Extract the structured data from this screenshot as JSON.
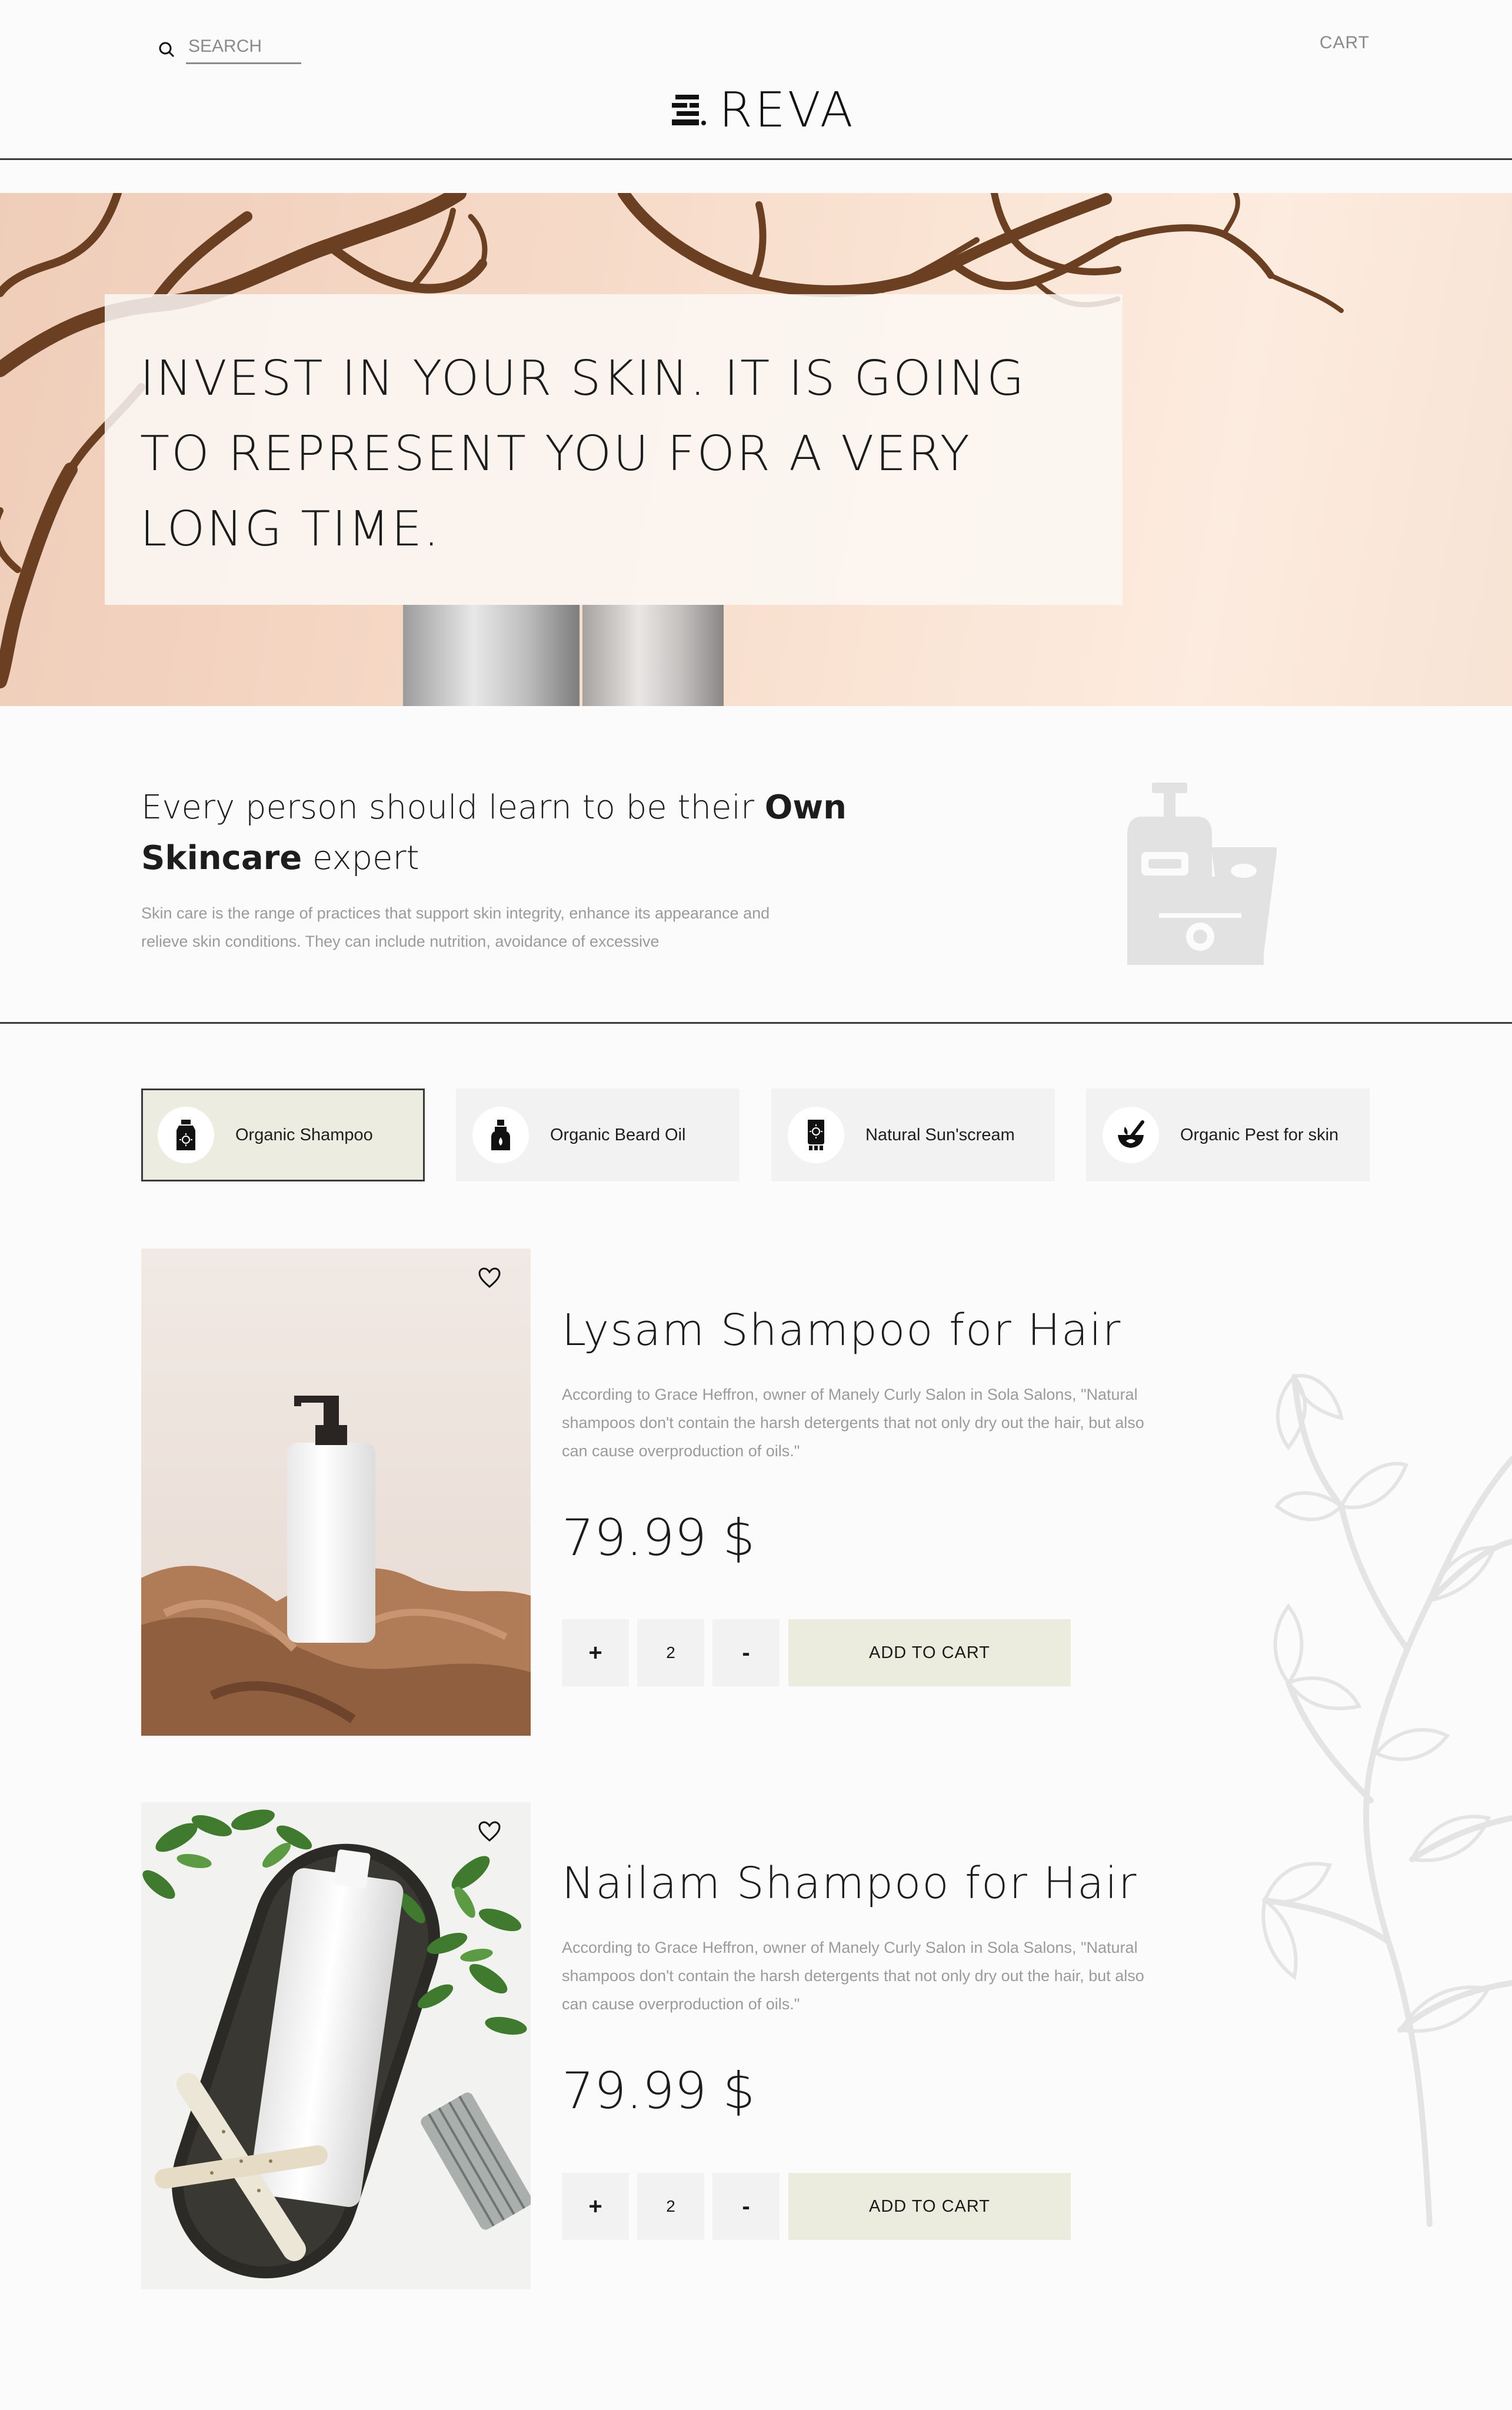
{
  "header": {
    "search_placeholder": "SEARCH",
    "cart_label": "CART",
    "brand_name": "REVA"
  },
  "hero": {
    "headline": "INVEST IN YOUR SKIN. IT IS GOING TO REPRESENT YOU FOR A VERY LONG TIME."
  },
  "intro": {
    "heading_part1": "Every person should learn to be their ",
    "heading_bold1": "Own Skincare",
    "heading_part2": " expert",
    "body": "Skin care is the range of practices that support skin integrity, enhance its appearance and relieve skin conditions. They can include nutrition, avoidance of excessive"
  },
  "categories": [
    {
      "label": "Organic Shampoo",
      "icon": "shampoo-bottle-icon",
      "active": true
    },
    {
      "label": "Organic Beard Oil",
      "icon": "oil-bottle-icon",
      "active": false
    },
    {
      "label": "Natural Sun'scream",
      "icon": "sunscreen-icon",
      "active": false
    },
    {
      "label": "Organic Pest for skin",
      "icon": "mortar-pestle-icon",
      "active": false
    }
  ],
  "products": [
    {
      "name": "Lysam Shampoo for Hair",
      "description": "According to Grace Heffron, owner of Manely Curly Salon in Sola Salons, \"Natural shampoos don't contain the harsh detergents that not only dry out the hair, but also can cause overproduction of oils.\"",
      "price": "79.99 $",
      "quantity": "2",
      "plus_label": "+",
      "minus_label": "-",
      "add_to_cart_label": "ADD TO CART"
    },
    {
      "name": "Nailam Shampoo for Hair",
      "description": "According to Grace Heffron, owner of Manely Curly Salon in Sola Salons, \"Natural shampoos don't contain the harsh detergents that not only dry out the hair, but also can cause overproduction of oils.\"",
      "price": "79.99 $",
      "quantity": "2",
      "plus_label": "+",
      "minus_label": "-",
      "add_to_cart_label": "ADD TO CART"
    }
  ],
  "colors": {
    "accent_beige": "#ecece0",
    "hero_peach": "#f6d9c7",
    "text_muted": "#9b9b9b",
    "divider": "#3a3a3a"
  }
}
